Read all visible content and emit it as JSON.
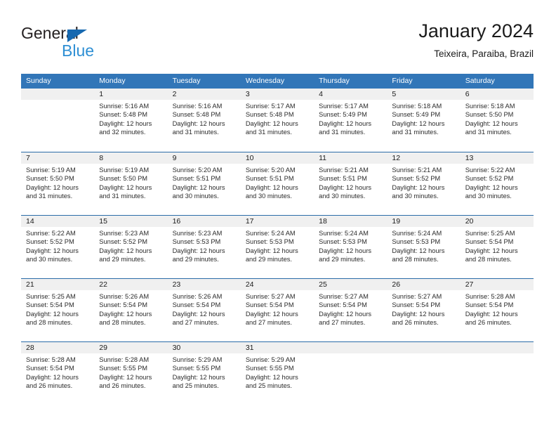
{
  "brand": {
    "name_dark": "General",
    "name_blue": "Blue",
    "accent_dark_blue": "#1769b0",
    "accent_light_blue": "#2e8fd4"
  },
  "header": {
    "title": "January 2024",
    "location": "Teixeira, Paraiba, Brazil"
  },
  "colors": {
    "header_row_bg": "#3276b8",
    "row_divider": "#2b6ca8",
    "daynum_band_bg": "#f0f0f0",
    "text": "#2b2b2b"
  },
  "weekdays": [
    "Sunday",
    "Monday",
    "Tuesday",
    "Wednesday",
    "Thursday",
    "Friday",
    "Saturday"
  ],
  "weeks": [
    [
      {
        "day": "",
        "sunrise": "",
        "sunset": "",
        "daylight_line1": "",
        "daylight_line2": ""
      },
      {
        "day": "1",
        "sunrise": "Sunrise: 5:16 AM",
        "sunset": "Sunset: 5:48 PM",
        "daylight_line1": "Daylight: 12 hours",
        "daylight_line2": "and 32 minutes."
      },
      {
        "day": "2",
        "sunrise": "Sunrise: 5:16 AM",
        "sunset": "Sunset: 5:48 PM",
        "daylight_line1": "Daylight: 12 hours",
        "daylight_line2": "and 31 minutes."
      },
      {
        "day": "3",
        "sunrise": "Sunrise: 5:17 AM",
        "sunset": "Sunset: 5:48 PM",
        "daylight_line1": "Daylight: 12 hours",
        "daylight_line2": "and 31 minutes."
      },
      {
        "day": "4",
        "sunrise": "Sunrise: 5:17 AM",
        "sunset": "Sunset: 5:49 PM",
        "daylight_line1": "Daylight: 12 hours",
        "daylight_line2": "and 31 minutes."
      },
      {
        "day": "5",
        "sunrise": "Sunrise: 5:18 AM",
        "sunset": "Sunset: 5:49 PM",
        "daylight_line1": "Daylight: 12 hours",
        "daylight_line2": "and 31 minutes."
      },
      {
        "day": "6",
        "sunrise": "Sunrise: 5:18 AM",
        "sunset": "Sunset: 5:50 PM",
        "daylight_line1": "Daylight: 12 hours",
        "daylight_line2": "and 31 minutes."
      }
    ],
    [
      {
        "day": "7",
        "sunrise": "Sunrise: 5:19 AM",
        "sunset": "Sunset: 5:50 PM",
        "daylight_line1": "Daylight: 12 hours",
        "daylight_line2": "and 31 minutes."
      },
      {
        "day": "8",
        "sunrise": "Sunrise: 5:19 AM",
        "sunset": "Sunset: 5:50 PM",
        "daylight_line1": "Daylight: 12 hours",
        "daylight_line2": "and 31 minutes."
      },
      {
        "day": "9",
        "sunrise": "Sunrise: 5:20 AM",
        "sunset": "Sunset: 5:51 PM",
        "daylight_line1": "Daylight: 12 hours",
        "daylight_line2": "and 30 minutes."
      },
      {
        "day": "10",
        "sunrise": "Sunrise: 5:20 AM",
        "sunset": "Sunset: 5:51 PM",
        "daylight_line1": "Daylight: 12 hours",
        "daylight_line2": "and 30 minutes."
      },
      {
        "day": "11",
        "sunrise": "Sunrise: 5:21 AM",
        "sunset": "Sunset: 5:51 PM",
        "daylight_line1": "Daylight: 12 hours",
        "daylight_line2": "and 30 minutes."
      },
      {
        "day": "12",
        "sunrise": "Sunrise: 5:21 AM",
        "sunset": "Sunset: 5:52 PM",
        "daylight_line1": "Daylight: 12 hours",
        "daylight_line2": "and 30 minutes."
      },
      {
        "day": "13",
        "sunrise": "Sunrise: 5:22 AM",
        "sunset": "Sunset: 5:52 PM",
        "daylight_line1": "Daylight: 12 hours",
        "daylight_line2": "and 30 minutes."
      }
    ],
    [
      {
        "day": "14",
        "sunrise": "Sunrise: 5:22 AM",
        "sunset": "Sunset: 5:52 PM",
        "daylight_line1": "Daylight: 12 hours",
        "daylight_line2": "and 30 minutes."
      },
      {
        "day": "15",
        "sunrise": "Sunrise: 5:23 AM",
        "sunset": "Sunset: 5:52 PM",
        "daylight_line1": "Daylight: 12 hours",
        "daylight_line2": "and 29 minutes."
      },
      {
        "day": "16",
        "sunrise": "Sunrise: 5:23 AM",
        "sunset": "Sunset: 5:53 PM",
        "daylight_line1": "Daylight: 12 hours",
        "daylight_line2": "and 29 minutes."
      },
      {
        "day": "17",
        "sunrise": "Sunrise: 5:24 AM",
        "sunset": "Sunset: 5:53 PM",
        "daylight_line1": "Daylight: 12 hours",
        "daylight_line2": "and 29 minutes."
      },
      {
        "day": "18",
        "sunrise": "Sunrise: 5:24 AM",
        "sunset": "Sunset: 5:53 PM",
        "daylight_line1": "Daylight: 12 hours",
        "daylight_line2": "and 29 minutes."
      },
      {
        "day": "19",
        "sunrise": "Sunrise: 5:24 AM",
        "sunset": "Sunset: 5:53 PM",
        "daylight_line1": "Daylight: 12 hours",
        "daylight_line2": "and 28 minutes."
      },
      {
        "day": "20",
        "sunrise": "Sunrise: 5:25 AM",
        "sunset": "Sunset: 5:54 PM",
        "daylight_line1": "Daylight: 12 hours",
        "daylight_line2": "and 28 minutes."
      }
    ],
    [
      {
        "day": "21",
        "sunrise": "Sunrise: 5:25 AM",
        "sunset": "Sunset: 5:54 PM",
        "daylight_line1": "Daylight: 12 hours",
        "daylight_line2": "and 28 minutes."
      },
      {
        "day": "22",
        "sunrise": "Sunrise: 5:26 AM",
        "sunset": "Sunset: 5:54 PM",
        "daylight_line1": "Daylight: 12 hours",
        "daylight_line2": "and 28 minutes."
      },
      {
        "day": "23",
        "sunrise": "Sunrise: 5:26 AM",
        "sunset": "Sunset: 5:54 PM",
        "daylight_line1": "Daylight: 12 hours",
        "daylight_line2": "and 27 minutes."
      },
      {
        "day": "24",
        "sunrise": "Sunrise: 5:27 AM",
        "sunset": "Sunset: 5:54 PM",
        "daylight_line1": "Daylight: 12 hours",
        "daylight_line2": "and 27 minutes."
      },
      {
        "day": "25",
        "sunrise": "Sunrise: 5:27 AM",
        "sunset": "Sunset: 5:54 PM",
        "daylight_line1": "Daylight: 12 hours",
        "daylight_line2": "and 27 minutes."
      },
      {
        "day": "26",
        "sunrise": "Sunrise: 5:27 AM",
        "sunset": "Sunset: 5:54 PM",
        "daylight_line1": "Daylight: 12 hours",
        "daylight_line2": "and 26 minutes."
      },
      {
        "day": "27",
        "sunrise": "Sunrise: 5:28 AM",
        "sunset": "Sunset: 5:54 PM",
        "daylight_line1": "Daylight: 12 hours",
        "daylight_line2": "and 26 minutes."
      }
    ],
    [
      {
        "day": "28",
        "sunrise": "Sunrise: 5:28 AM",
        "sunset": "Sunset: 5:54 PM",
        "daylight_line1": "Daylight: 12 hours",
        "daylight_line2": "and 26 minutes."
      },
      {
        "day": "29",
        "sunrise": "Sunrise: 5:28 AM",
        "sunset": "Sunset: 5:55 PM",
        "daylight_line1": "Daylight: 12 hours",
        "daylight_line2": "and 26 minutes."
      },
      {
        "day": "30",
        "sunrise": "Sunrise: 5:29 AM",
        "sunset": "Sunset: 5:55 PM",
        "daylight_line1": "Daylight: 12 hours",
        "daylight_line2": "and 25 minutes."
      },
      {
        "day": "31",
        "sunrise": "Sunrise: 5:29 AM",
        "sunset": "Sunset: 5:55 PM",
        "daylight_line1": "Daylight: 12 hours",
        "daylight_line2": "and 25 minutes."
      },
      {
        "day": "",
        "sunrise": "",
        "sunset": "",
        "daylight_line1": "",
        "daylight_line2": ""
      },
      {
        "day": "",
        "sunrise": "",
        "sunset": "",
        "daylight_line1": "",
        "daylight_line2": ""
      },
      {
        "day": "",
        "sunrise": "",
        "sunset": "",
        "daylight_line1": "",
        "daylight_line2": ""
      }
    ]
  ]
}
